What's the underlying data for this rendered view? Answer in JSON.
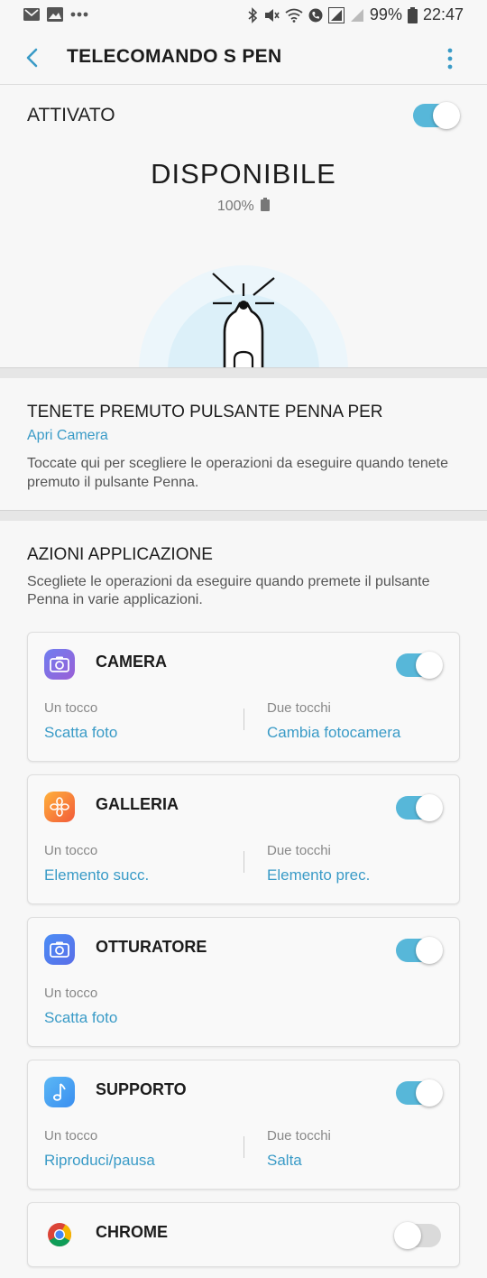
{
  "status_bar": {
    "left_icons": [
      "mail-icon",
      "image-icon",
      "more-dots-icon"
    ],
    "right_icons": [
      "bluetooth-icon",
      "mute-icon",
      "wifi-icon",
      "call-icon",
      "signal-icon",
      "signal-empty-icon",
      "battery-icon"
    ],
    "battery_percent": "99%",
    "time": "22:47"
  },
  "header": {
    "title": "TELECOMANDO S PEN"
  },
  "activation": {
    "label": "ATTIVATO",
    "enabled": true
  },
  "pen_status": {
    "state": "DISPONIBILE",
    "battery": "100%"
  },
  "hold_action": {
    "title": "TENETE PREMUTO PULSANTE PENNA PER",
    "value": "Apri Camera",
    "description": "Toccate qui per scegliere le operazioni da eseguire quando tenete premuto il pulsante Penna."
  },
  "app_actions": {
    "title": "AZIONI APPLICAZIONE",
    "description": "Scegliete le operazioni da eseguire quando premete il pulsante Penna in varie applicazioni.",
    "apps": [
      {
        "name": "CAMERA",
        "icon": "camera-icon",
        "enabled": true,
        "single_label": "Un tocco",
        "single_value": "Scatta foto",
        "double_label": "Due tocchi",
        "double_value": "Cambia fotocamera"
      },
      {
        "name": "GALLERIA",
        "icon": "gallery-icon",
        "enabled": true,
        "single_label": "Un tocco",
        "single_value": "Elemento succ.",
        "double_label": "Due tocchi",
        "double_value": "Elemento prec."
      },
      {
        "name": "OTTURATORE",
        "icon": "shutter-camera-icon",
        "enabled": true,
        "single_label": "Un tocco",
        "single_value": "Scatta foto"
      },
      {
        "name": "SUPPORTO",
        "icon": "music-note-icon",
        "enabled": true,
        "single_label": "Un tocco",
        "single_value": "Riproduci/pausa",
        "double_label": "Due tocchi",
        "double_value": "Salta"
      },
      {
        "name": "CHROME",
        "icon": "chrome-icon",
        "enabled": false
      }
    ]
  },
  "colors": {
    "accent": "#3a9bc7",
    "toggle_on": "#57b7d9"
  }
}
